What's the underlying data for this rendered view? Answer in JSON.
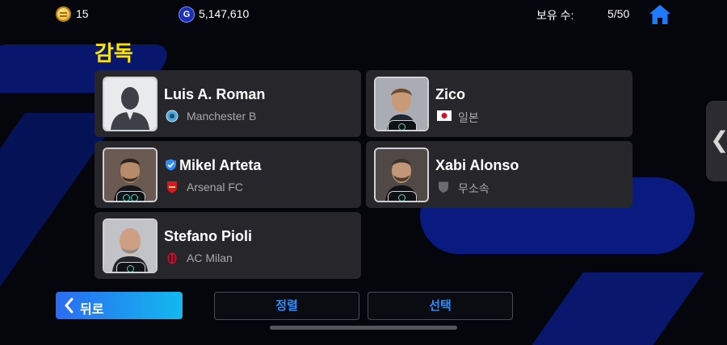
{
  "topbar": {
    "coins": "15",
    "gp": "5,147,610",
    "gp_icon_letter": "G",
    "owned_label": "보유 수:",
    "owned_value": "5/50"
  },
  "section_title": "감독",
  "coaches": [
    {
      "name": "Luis A. Roman",
      "team": "Manchester B",
      "team_icon": "manchester-b-crest-icon",
      "portrait": "silhouette"
    },
    {
      "name": "Zico",
      "team": "일본",
      "team_icon": "japan-flag-icon",
      "portrait": "photo"
    },
    {
      "name": "Mikel Arteta",
      "team": "Arsenal FC",
      "team_icon": "arsenal-crest-icon",
      "portrait": "photo",
      "verified": true
    },
    {
      "name": "Xabi Alonso",
      "team": "무소속",
      "team_icon": "free-agent-shield-icon",
      "portrait": "photo"
    },
    {
      "name": "Stefano Pioli",
      "team": "AC Milan",
      "team_icon": "ac-milan-crest-icon",
      "portrait": "photo"
    }
  ],
  "buttons": {
    "back": "뒤로",
    "sort": "정렬",
    "select": "선택"
  },
  "colors": {
    "accent_yellow": "#ffe400",
    "button_blue": "#2f8cff",
    "card_bg": "#27272b"
  }
}
